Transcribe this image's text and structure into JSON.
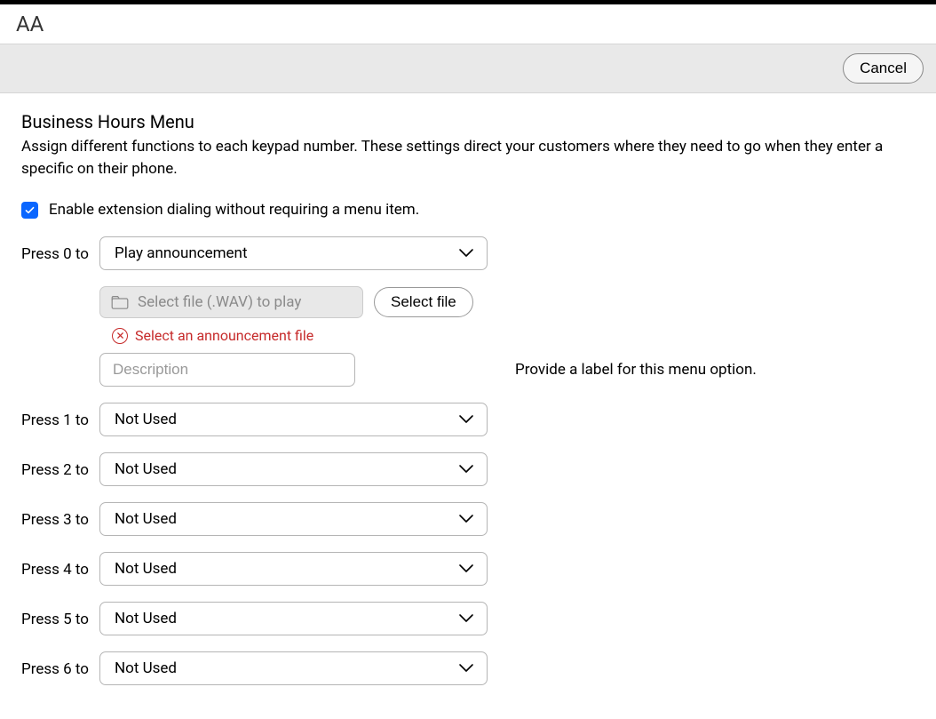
{
  "topbar": {
    "title": "AA"
  },
  "actionbar": {
    "cancel_label": "Cancel"
  },
  "section": {
    "title": "Business Hours Menu",
    "description": "Assign different functions to each keypad number. These settings direct your customers where they need to go when they enter a specific on their phone."
  },
  "enable_ext": {
    "label": "Enable extension dialing without requiring a menu item."
  },
  "press0": {
    "label": "Press 0 to",
    "value": "Play announcement",
    "file_placeholder": "Select file (.WAV) to play",
    "select_file_btn": "Select file",
    "error_text": "Select an announcement file",
    "desc_placeholder": "Description",
    "desc_hint": "Provide a label for this menu option."
  },
  "rows": [
    {
      "label": "Press 1 to",
      "value": "Not Used"
    },
    {
      "label": "Press 2 to",
      "value": "Not Used"
    },
    {
      "label": "Press 3 to",
      "value": "Not Used"
    },
    {
      "label": "Press 4 to",
      "value": "Not Used"
    },
    {
      "label": "Press 5 to",
      "value": "Not Used"
    },
    {
      "label": "Press 6 to",
      "value": "Not Used"
    }
  ]
}
